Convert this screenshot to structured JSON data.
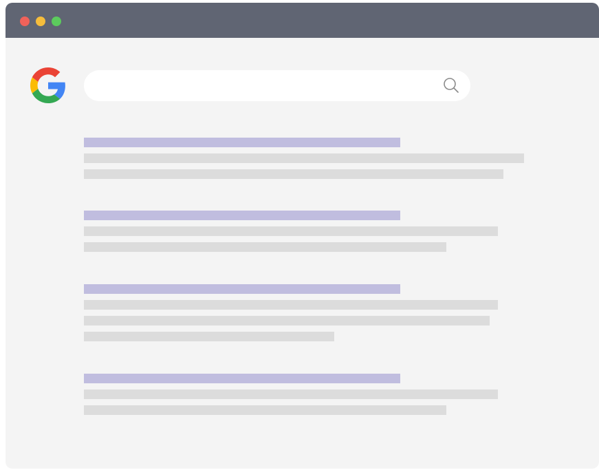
{
  "window": {
    "traffic_lights": [
      {
        "name": "close",
        "color": "#f0625a"
      },
      {
        "name": "minimize",
        "color": "#f5bd3c"
      },
      {
        "name": "maximize",
        "color": "#5ccb5d"
      }
    ],
    "titlebar_color": "#606573",
    "content_color": "#f4f4f4"
  },
  "header": {
    "logo": "google-g-logo"
  },
  "search": {
    "value": "",
    "placeholder": "",
    "icon": "search-icon"
  },
  "results": {
    "title_bar_color": "#c0bddf",
    "snippet_bar_color": "#dcdcdc",
    "items": [
      {
        "title_length": 460,
        "snippet_lengths": [
          640,
          610
        ]
      },
      {
        "title_length": 460,
        "snippet_lengths": [
          602,
          527
        ]
      },
      {
        "title_length": 460,
        "snippet_lengths": [
          602,
          590,
          364
        ]
      },
      {
        "title_length": 460,
        "snippet_lengths": [
          602,
          527
        ]
      }
    ]
  }
}
